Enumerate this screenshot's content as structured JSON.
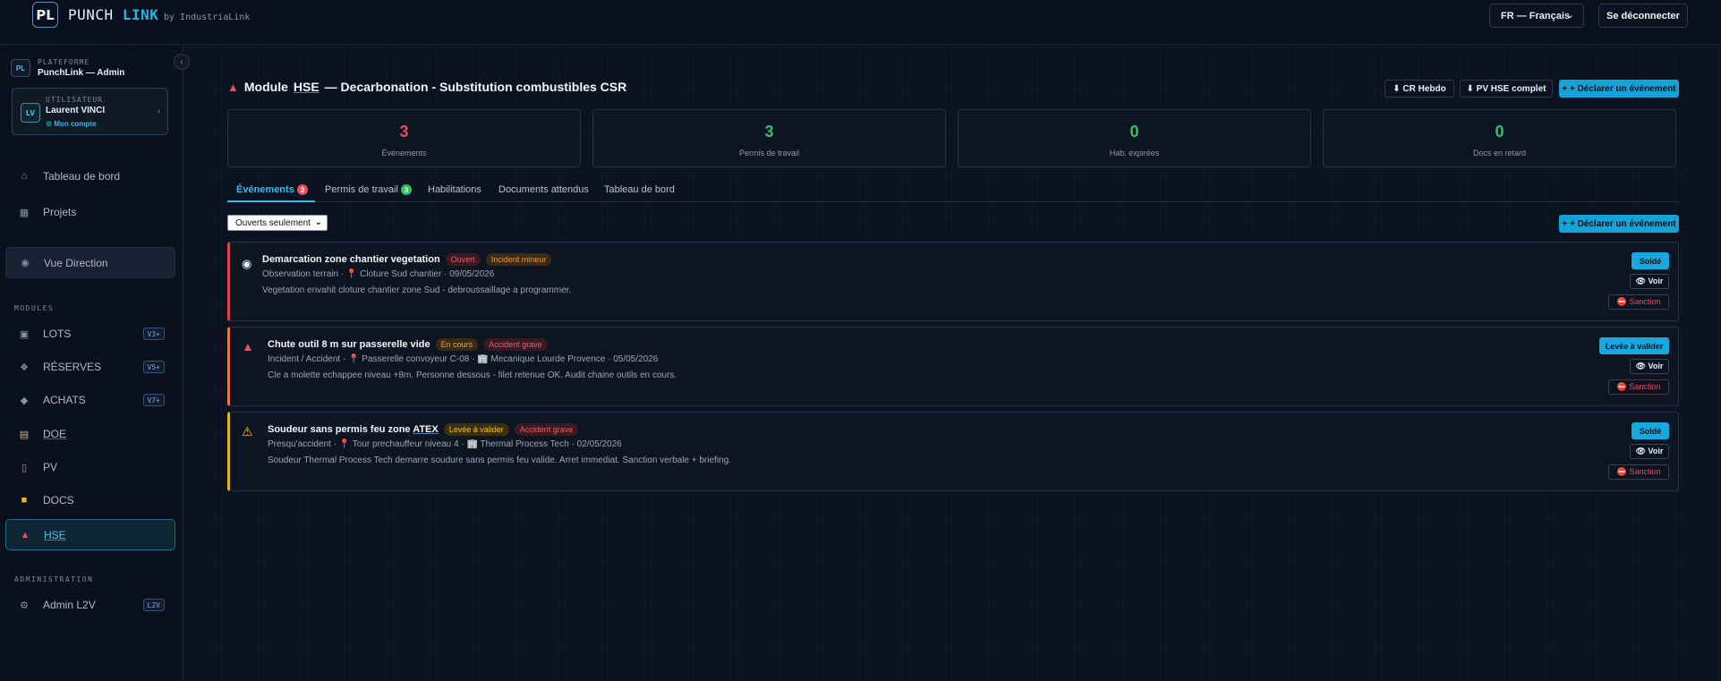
{
  "app": {
    "logo_letters": "PL",
    "name_part1": "PUNCH",
    "name_part2": "LINK",
    "by": "by IndustriaLink"
  },
  "header": {
    "language": "FR — Français",
    "logout_label": "Se déconnecter"
  },
  "sidebar": {
    "platform_badge": "PL",
    "platform_label": "PLATEFORME",
    "platform_name": "PunchLink — Admin",
    "user": {
      "initials": "LV",
      "label": "UTILISATEUR",
      "name": "Laurent VINCI",
      "account_link": "⚙ Mon compte"
    },
    "nav": {
      "dashboard": "Tableau de bord",
      "projects": "Projets",
      "direction": "Vue Direction"
    },
    "modules_label": "MODULES",
    "modules": [
      {
        "label": "LOTS",
        "badge": "V3+"
      },
      {
        "label": "RÉSERVES",
        "badge": "V5+"
      },
      {
        "label": "ACHATS",
        "badge": "V7+"
      },
      {
        "label": "DOE",
        "badge": ""
      },
      {
        "label": "PV",
        "badge": ""
      },
      {
        "label": "DOCS",
        "badge": ""
      },
      {
        "label": "HSE",
        "badge": ""
      }
    ],
    "admin_label": "ADMINISTRATION",
    "admin_item": {
      "label": "Admin L2V",
      "badge": "L2V"
    }
  },
  "main": {
    "title_prefix": "Module",
    "title_hse": "HSE",
    "title_rest": "— Decarbonation - Substitution combustibles CSR",
    "buttons": {
      "cr_hebdo": "⬇ CR Hebdo",
      "pv_hse": "⬇ PV HSE complet",
      "declare": "+ + Déclarer un événement"
    },
    "stats": [
      {
        "value": "3",
        "label": "Événements",
        "color": "#ef4a5e"
      },
      {
        "value": "3",
        "label": "Permis de travail",
        "color": "#2ec46a"
      },
      {
        "value": "0",
        "label": "Hab. expirées",
        "color": "#2ec46a"
      },
      {
        "value": "0",
        "label": "Docs en retard",
        "color": "#2ec46a"
      }
    ],
    "tabs": {
      "events": "Événements",
      "events_count": "3",
      "permits": "Permis de travail",
      "permits_count": "3",
      "habilitations": "Habilitations",
      "documents": "Documents attendus",
      "dashboard": "Tableau de bord"
    },
    "filter": "Ouverts seulement",
    "declare_btn": "+ + Déclarer un événement"
  },
  "events": [
    {
      "title": "Demarcation zone chantier vegetation",
      "status": "Ouvert",
      "severity": "Incident mineur",
      "meta": "Observation terrain · 📍 Cloture Sud chantier · 09/05/2026",
      "desc": "Vegetation envahit cloture chantier zone Sud - debroussaillage a programmer.",
      "action": "Soldé",
      "view": "👁 Voir",
      "sanction": "⛔ Sanction"
    },
    {
      "title": "Chute outil 8 m sur passerelle vide",
      "status": "En cours",
      "severity": "Accident grave",
      "meta": "Incident / Accident · 📍 Passerelle convoyeur C-08 · 🏢 Mecanique Lourde Provence · 05/05/2026",
      "desc": "Cle a molette echappee niveau +8m. Personne dessous - filet retenue OK. Audit chaine outils en cours.",
      "action": "Levée à valider",
      "view": "👁 Voir",
      "sanction": "⛔ Sanction"
    },
    {
      "title_main": "Soudeur sans permis feu zone",
      "title_ul": "ATEX",
      "status": "Levée à valider",
      "severity": "Accident grave",
      "meta": "Presqu'accident · 📍 Tour prechauffeur niveau 4 · 🏢 Thermal Process Tech · 02/05/2026",
      "desc": "Soudeur Thermal Process Tech demarre soudure sans permis feu valide. Arret immediat. Sanction verbale + briefing.",
      "action": "Soldé",
      "view": "👁 Voir",
      "sanction": "⛔ Sanction"
    }
  ]
}
